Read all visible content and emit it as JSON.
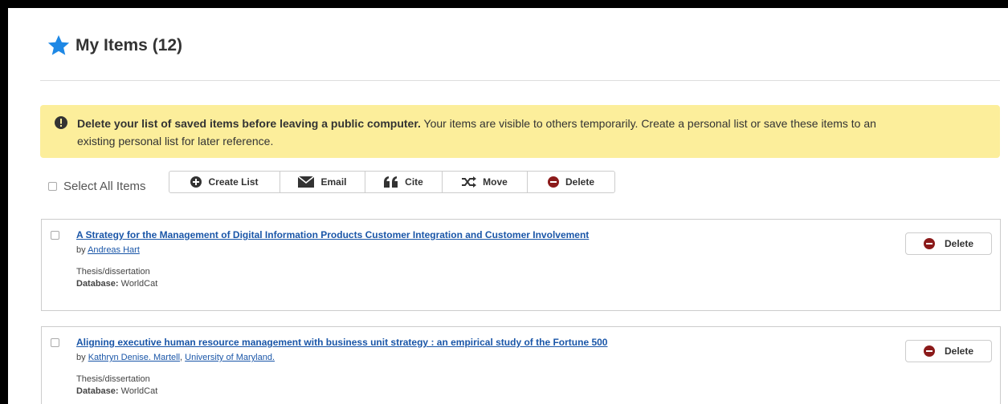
{
  "page": {
    "title": "My Items (12)"
  },
  "alert": {
    "bold_text": "Delete your list of saved items before leaving a public computer.",
    "text_line1": " Your items are visible to others temporarily. Create a personal list or save these items to an",
    "text_line2": "existing personal list for later reference."
  },
  "select_all_label": "Select All Items",
  "toolbar": {
    "create_list": "Create List",
    "email": "Email",
    "cite": "Cite",
    "move": "Move",
    "delete": "Delete"
  },
  "items": [
    {
      "title": "A Strategy for the Management of Digital Information Products Customer Integration and Customer Involvement",
      "by_prefix": "by ",
      "authors": [
        "Andreas Hart"
      ],
      "type": "Thesis/dissertation",
      "db_label": "Database:",
      "db_value": " WorldCat",
      "delete_label": "Delete"
    },
    {
      "title": "Aligning executive human resource management with business unit strategy : an empirical study of the Fortune 500",
      "by_prefix": "by ",
      "authors": [
        "Kathryn Denise. Martell",
        "University of Maryland."
      ],
      "author_separator": ", ",
      "type": "Thesis/dissertation",
      "db_label": "Database:",
      "db_value": " WorldCat",
      "delete_label": "Delete"
    }
  ],
  "colors": {
    "accent_star": "#1e88e5",
    "alert_bg": "#fcee9b",
    "link": "#1a56a8",
    "delete_icon": "#8b1a1a"
  }
}
